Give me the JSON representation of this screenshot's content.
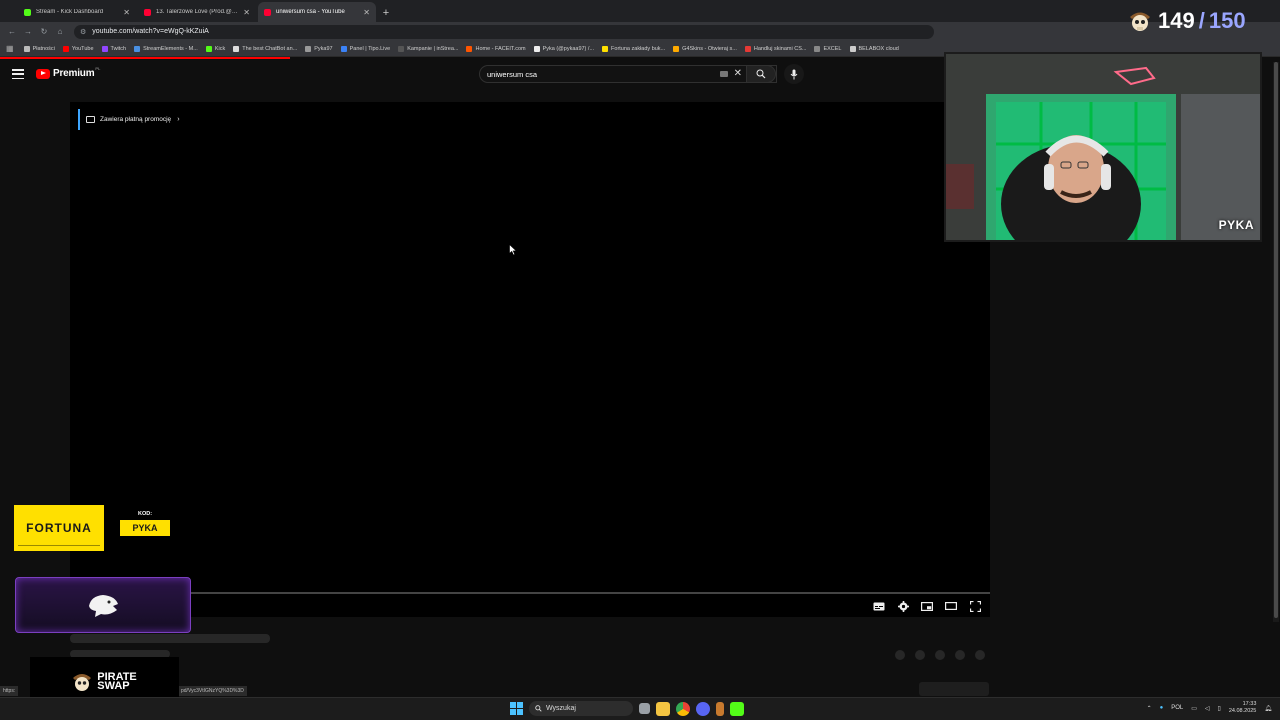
{
  "browser": {
    "tabs": [
      {
        "title": "Stream - Kick Dashboard",
        "favicon_color": "#53fc18",
        "active": false
      },
      {
        "title": "13. Talerzowe Love (Prod.@Jas...",
        "favicon_color": "#ff0033",
        "active": false
      },
      {
        "title": "uniwersum csa - YouTube",
        "favicon_color": "#ff0033",
        "active": true
      }
    ],
    "url": "youtube.com/watch?v=eWgQ-kKZuiA",
    "bookmarks": [
      {
        "label": "Płatności",
        "color": "#bbbbbb"
      },
      {
        "label": "YouTube",
        "color": "#ff0000"
      },
      {
        "label": "Twitch",
        "color": "#9146ff"
      },
      {
        "label": "StreamElements - M...",
        "color": "#4a90e2"
      },
      {
        "label": "Kick",
        "color": "#53fc18"
      },
      {
        "label": "The best ChatBot an...",
        "color": "#dddddd"
      },
      {
        "label": "Pyka97",
        "color": "#999999"
      },
      {
        "label": "Panel | Tipo.Live",
        "color": "#3b82f6"
      },
      {
        "label": "Kampanie | inStrea...",
        "color": "#555555"
      },
      {
        "label": "Home - FACEIT.com",
        "color": "#ff5500"
      },
      {
        "label": "Pyka (@pykaa97) /...",
        "color": "#eeeeee"
      },
      {
        "label": "Fortuna zakłady buk...",
        "color": "#ffe000"
      },
      {
        "label": "G4Skins - Otwieraj s...",
        "color": "#ffaa00"
      },
      {
        "label": "Handluj skinami CS...",
        "color": "#e53935"
      },
      {
        "label": "EXCEL",
        "color": "#888888"
      },
      {
        "label": "BELABOX cloud",
        "color": "#cccccc"
      }
    ]
  },
  "youtube": {
    "logo_text": "Premium",
    "logo_region": "PL",
    "search_value": "uniwersum csa",
    "promo_label": "Zawiera płatną promocję",
    "accent": "#ff0000"
  },
  "status_url_left": "https:",
  "status_url_right": "pd/Vyc3VtIGNzYQ%3D%3D",
  "overlay": {
    "counter_current": "149",
    "counter_separator": "/",
    "counter_total": "150",
    "webcam_name": "PYKA",
    "fortuna_brand": "FORTUNA",
    "code_label": "KOD:",
    "code_value": "PYKA",
    "pirate_line1": "PIRATE",
    "pirate_line2": "SWAP"
  },
  "taskbar": {
    "search_placeholder": "Wyszukaj",
    "lang": "POL",
    "time": "17:33",
    "date": "24.08.2025"
  }
}
